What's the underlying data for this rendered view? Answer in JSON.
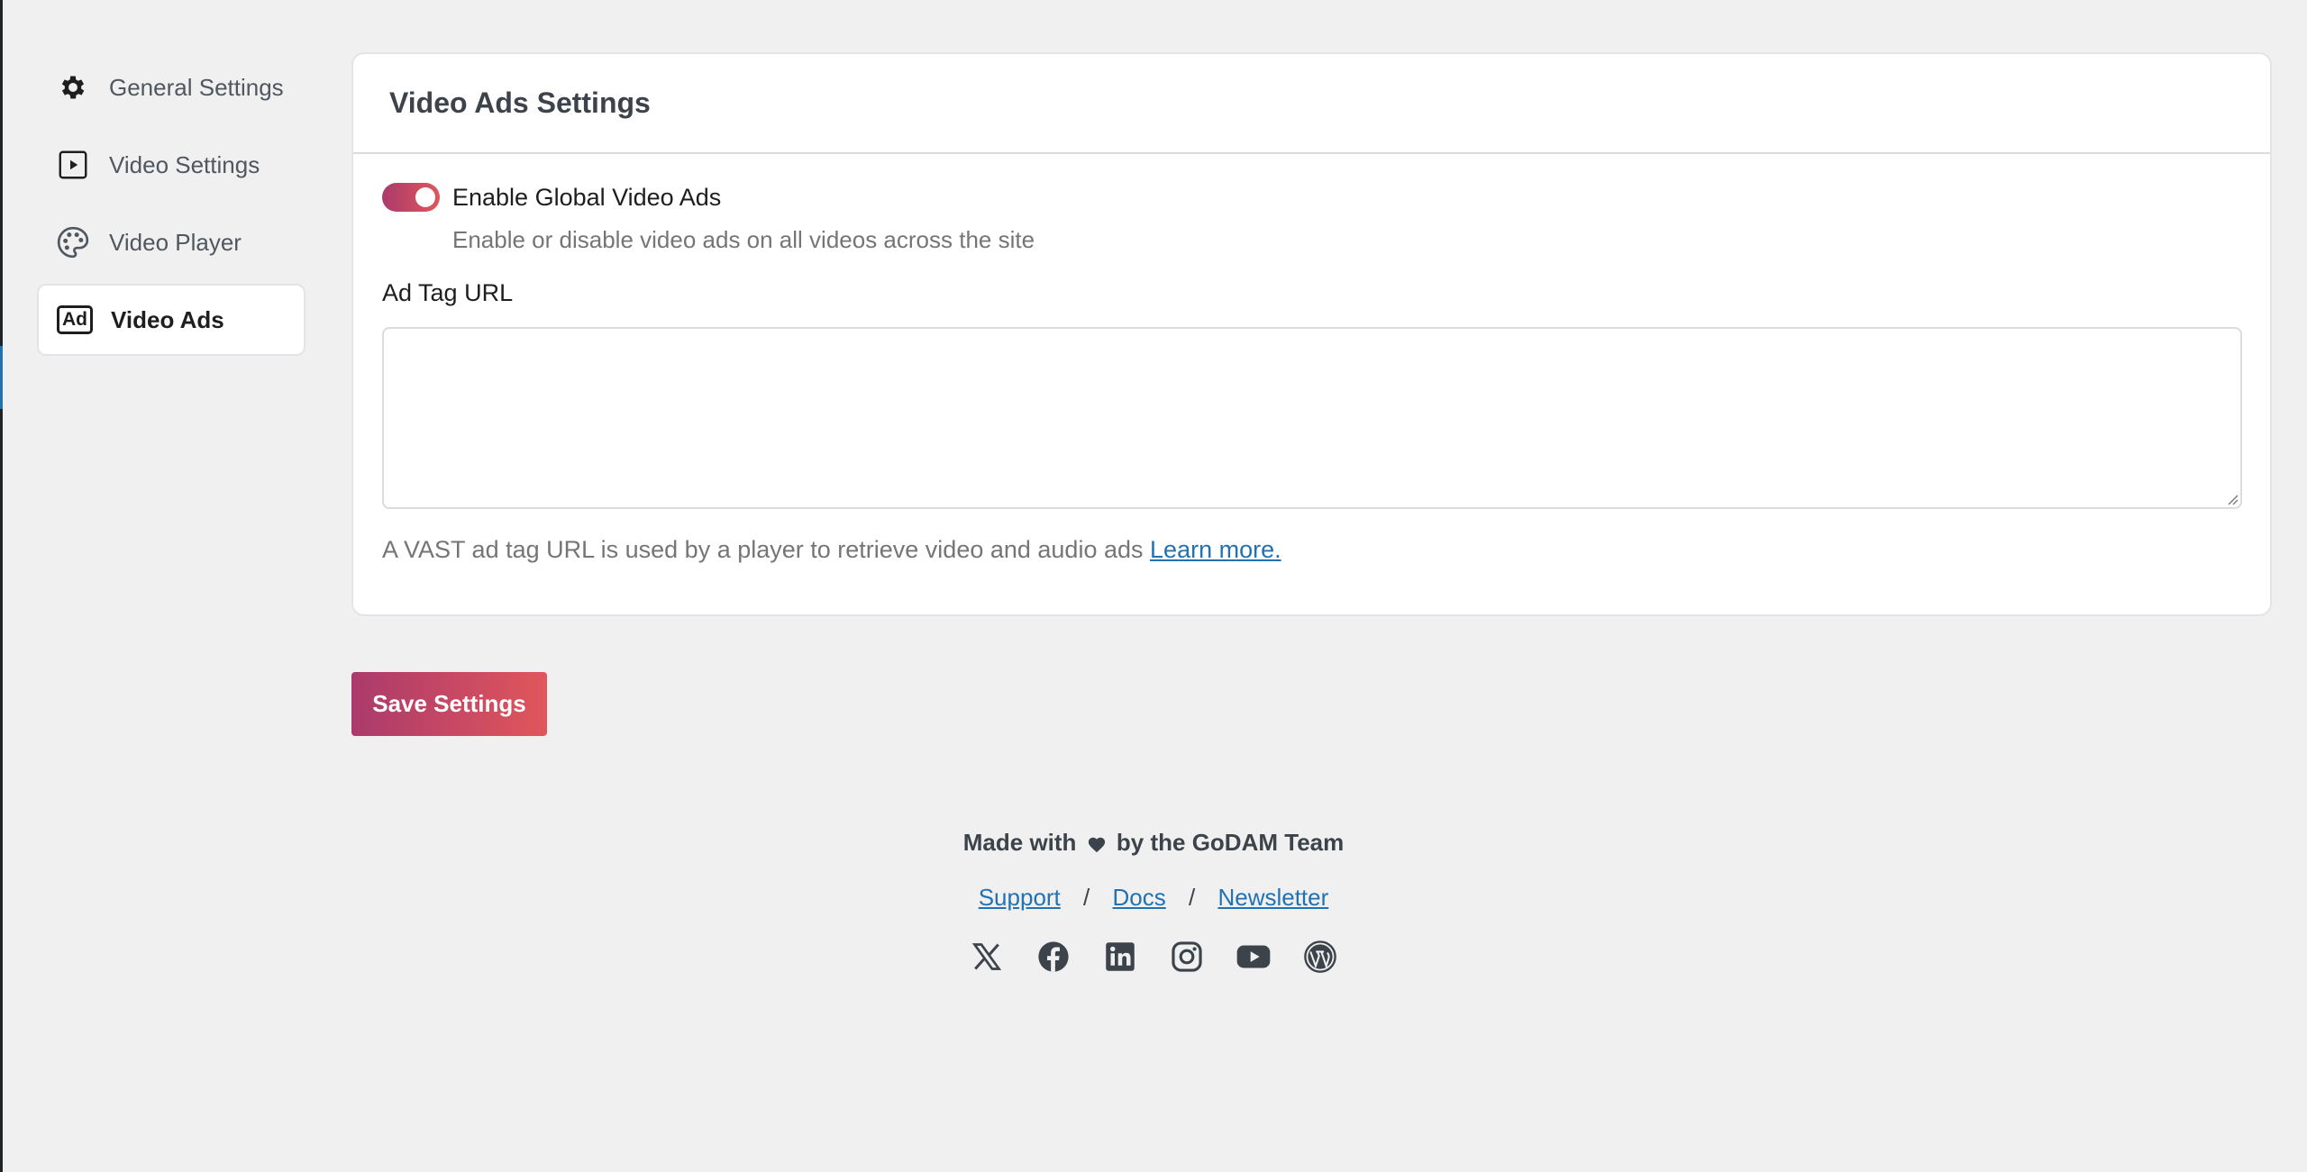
{
  "sidebar": {
    "items": [
      {
        "label": "General Settings",
        "icon": "gear-icon"
      },
      {
        "label": "Video Settings",
        "icon": "play-square-icon"
      },
      {
        "label": "Video Player",
        "icon": "palette-icon"
      },
      {
        "label": "Video Ads",
        "icon": "ad-icon",
        "badge": "Ad",
        "active": true
      }
    ]
  },
  "card": {
    "title": "Video Ads Settings",
    "toggle_label": "Enable Global Video Ads",
    "toggle_on": true,
    "toggle_help": "Enable or disable video ads on all videos across the site",
    "ad_tag_label": "Ad Tag URL",
    "ad_tag_value": "",
    "ad_tag_help": "A VAST ad tag URL is used by a player to retrieve video and audio ads",
    "learn_more": "Learn more."
  },
  "save_label": "Save Settings",
  "footer": {
    "made_with_prefix": "Made with",
    "made_with_suffix": "by the GoDAM Team",
    "links": [
      "Support",
      "Docs",
      "Newsletter"
    ],
    "separator": "/",
    "socials": [
      "x-icon",
      "facebook-icon",
      "linkedin-icon",
      "instagram-icon",
      "youtube-icon",
      "wordpress-icon"
    ]
  },
  "colors": {
    "accent_start": "#ab3a6c",
    "accent_end": "#e0565b",
    "link": "#2271b1"
  }
}
